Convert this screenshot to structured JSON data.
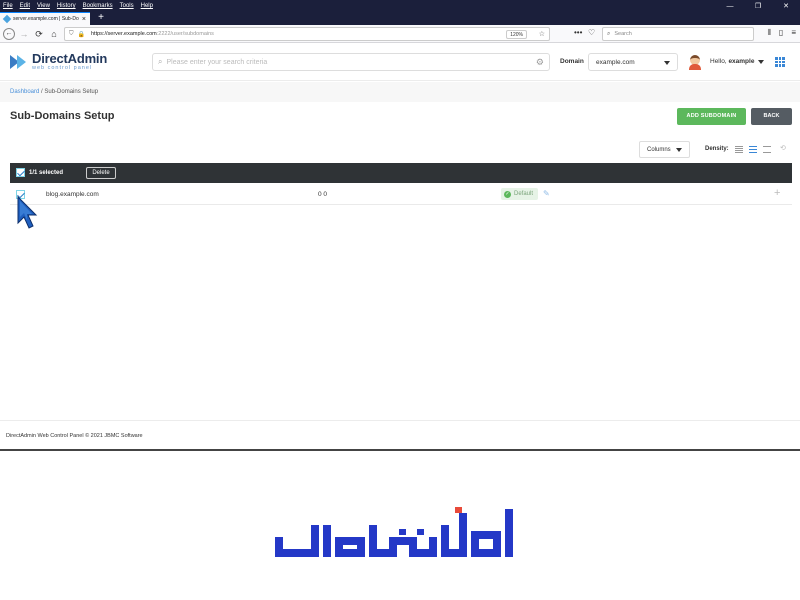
{
  "browser": {
    "menu": [
      "File",
      "Edit",
      "View",
      "History",
      "Bookmarks",
      "Tools",
      "Help"
    ],
    "window_controls": [
      "—",
      "❐",
      "✕"
    ],
    "tab_title": "server.example.com | Sub-Do",
    "tab_close": "×",
    "new_tab": "+",
    "url_host": "https://server.example.com",
    "url_path": ":2222/user/subdomains",
    "zoom": "120%",
    "search_placeholder": "Search"
  },
  "header": {
    "logo_title": "DirectAdmin",
    "logo_subtitle": "web control panel",
    "search_placeholder": "Please enter your search criteria",
    "domain_label": "Domain",
    "domain_value": "example.com",
    "hello_prefix": "Hello,",
    "username": "example"
  },
  "breadcrumb": {
    "link": "Dashboard",
    "separator": " / ",
    "current": "Sub-Domains Setup"
  },
  "page": {
    "title": "Sub-Domains Setup",
    "add_button": "ADD SUBDOMAIN",
    "back_button": "BACK"
  },
  "toolbar": {
    "columns_label": "Columns",
    "density_label": "Density:"
  },
  "table": {
    "selection_count": "1/1 selected",
    "delete_label": "Delete",
    "rows": [
      {
        "domain": "blog.example.com",
        "usage": "0 0",
        "badge": "Default",
        "checked": true
      }
    ]
  },
  "footer": {
    "text": "DirectAdmin Web Control Panel © 2021 JBMC Software"
  },
  "colors": {
    "accent": "#3a87d6",
    "success": "#5cb85c",
    "dark_bar": "#2f3336",
    "brand_blue": "#2438c7"
  }
}
